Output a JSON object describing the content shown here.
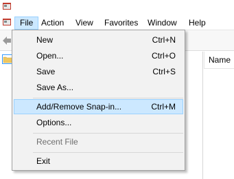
{
  "menubar": {
    "items": [
      "File",
      "Action",
      "View",
      "Favorites",
      "Window",
      "Help"
    ],
    "active_item": "File"
  },
  "file_menu": {
    "items": [
      {
        "label": "New",
        "shortcut": "Ctrl+N"
      },
      {
        "label": "Open...",
        "shortcut": "Ctrl+O"
      },
      {
        "label": "Save",
        "shortcut": "Ctrl+S"
      },
      {
        "label": "Save As...",
        "shortcut": ""
      },
      {
        "label": "Add/Remove Snap-in...",
        "shortcut": "Ctrl+M",
        "highlighted": true
      },
      {
        "label": "Options...",
        "shortcut": ""
      },
      {
        "label": "Recent File",
        "shortcut": "",
        "disabled": true
      },
      {
        "label": "Exit",
        "shortcut": ""
      }
    ]
  },
  "list_pane": {
    "column_header": "Name"
  },
  "colors": {
    "highlight_bg": "#cce8ff",
    "highlight_border": "#99d1ff",
    "menu_bg": "#f2f2f2",
    "disabled_text": "#6d6d6d"
  }
}
